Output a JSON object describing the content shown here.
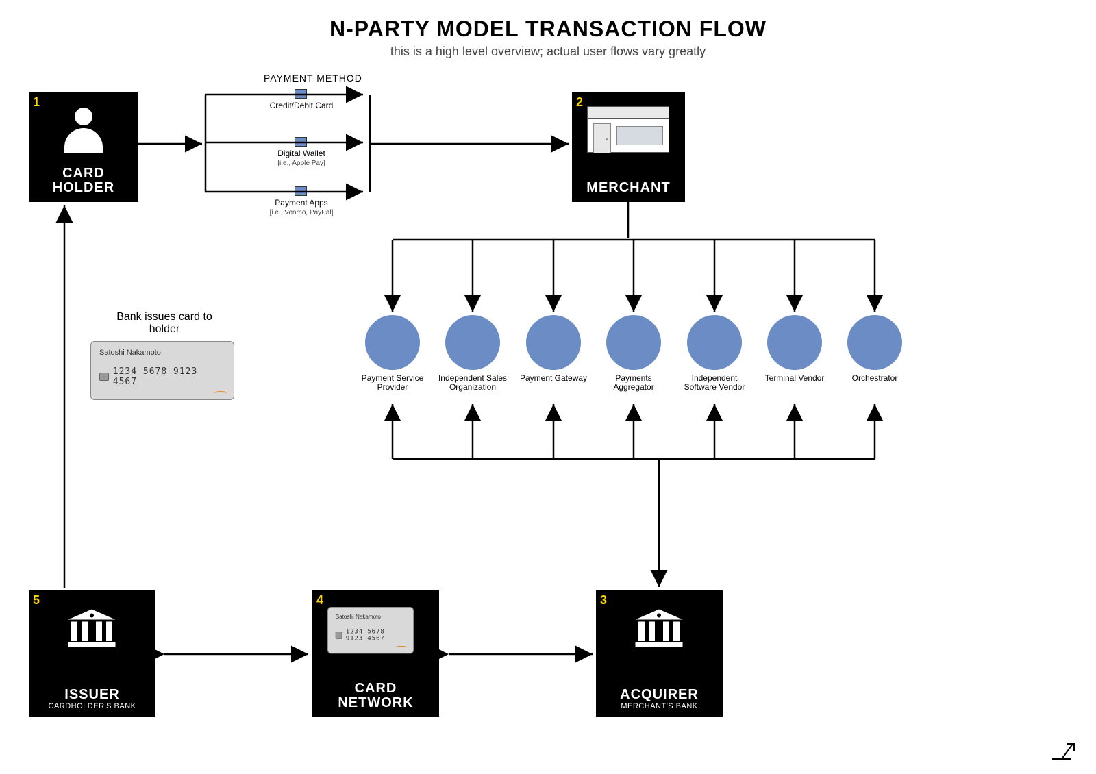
{
  "title": "N-PARTY MODEL TRANSACTION FLOW",
  "subtitle": "this is a high level overview; actual user flows vary greatly",
  "payment_method_header": "PAYMENT METHOD",
  "payment_methods": [
    {
      "label": "Credit/Debit Card",
      "sub": ""
    },
    {
      "label": "Digital Wallet",
      "sub": "[i.e., Apple Pay]"
    },
    {
      "label": "Payment Apps",
      "sub": "[i.e., Venmo, PayPal]"
    }
  ],
  "boxes": {
    "cardholder": {
      "num": "1",
      "label1": "CARD",
      "label2": "HOLDER"
    },
    "merchant": {
      "num": "2",
      "label": "MERCHANT"
    },
    "acquirer": {
      "num": "3",
      "label": "ACQUIRER",
      "sub": "MERCHANT'S BANK"
    },
    "network": {
      "num": "4",
      "label1": "CARD",
      "label2": "NETWORK"
    },
    "issuer": {
      "num": "5",
      "label": "ISSUER",
      "sub": "CARDHOLDER'S BANK"
    }
  },
  "intermediaries": [
    "Payment Service Provider",
    "Independent Sales Organization",
    "Payment Gateway",
    "Payments Aggregator",
    "Independent Software Vendor",
    "Terminal Vendor",
    "Orchestrator"
  ],
  "issue_note": "Bank issues card to holder",
  "card": {
    "name": "Satoshi Nakamoto",
    "pan": "1234 5678 9123 4567"
  }
}
